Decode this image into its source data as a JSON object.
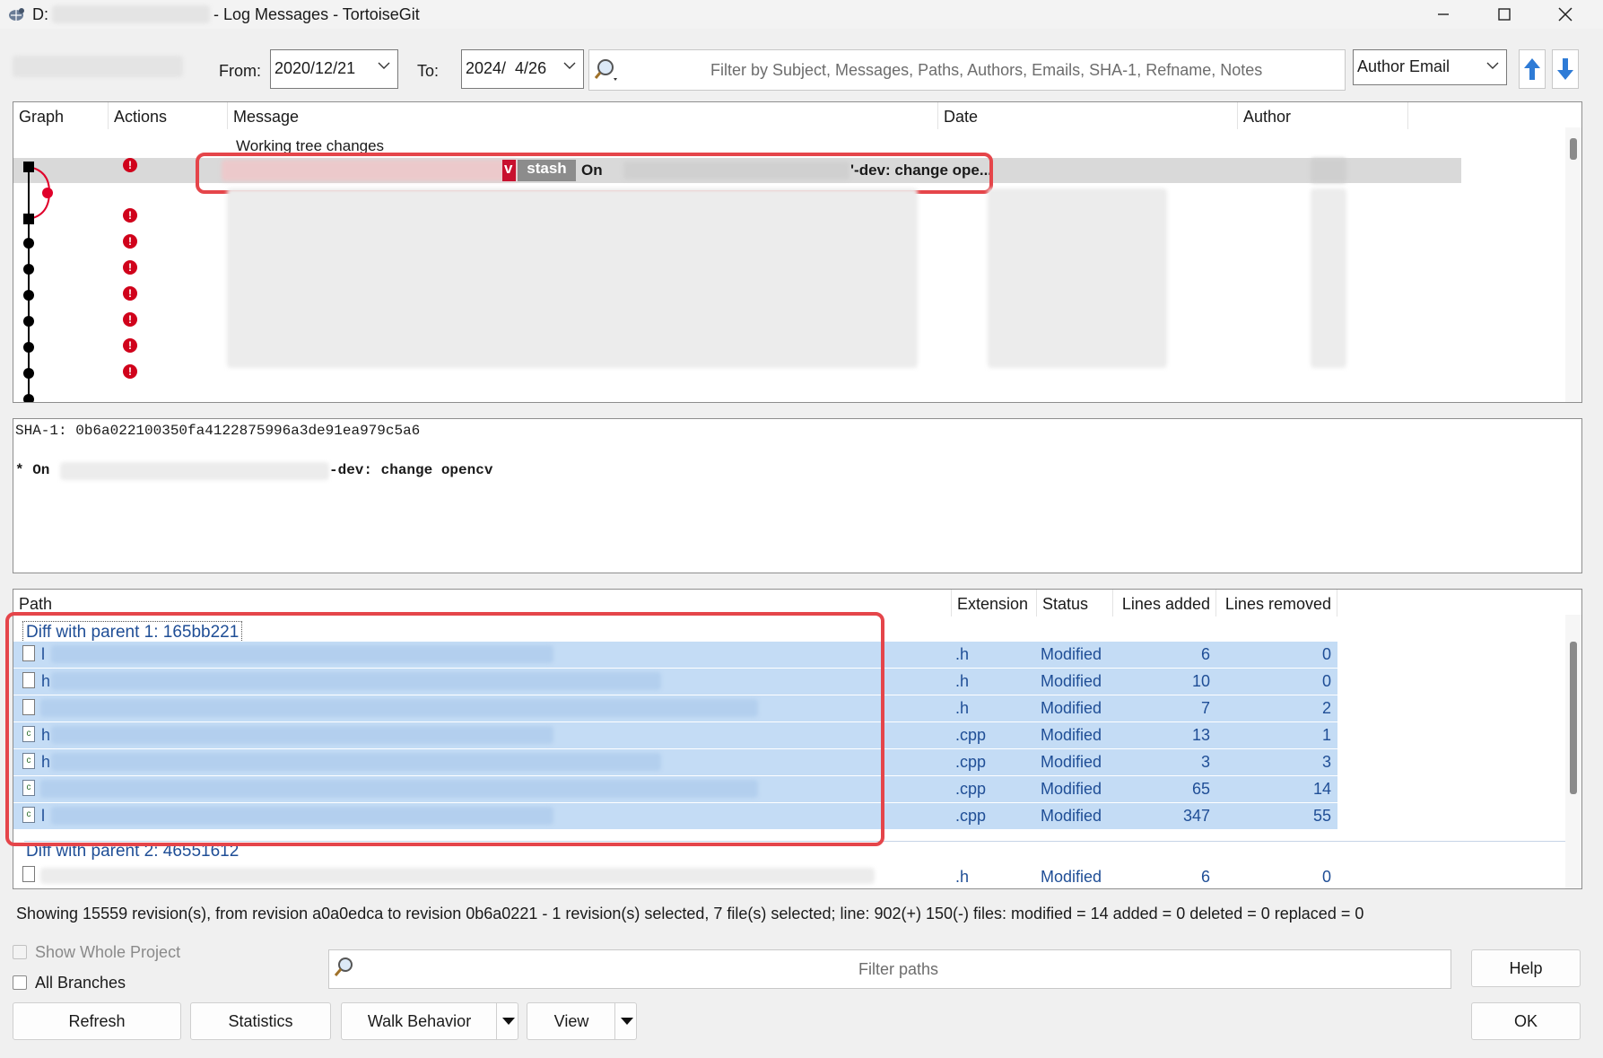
{
  "window": {
    "title_prefix": "D:",
    "title_suffix": "- Log Messages - TortoiseGit"
  },
  "toolbar": {
    "from_label": "From:",
    "from_value": "2020/12/21",
    "to_label": "To:",
    "to_value": "2024/  4/26",
    "filter_placeholder": "Filter by Subject, Messages, Paths, Authors, Emails, SHA-1, Refname, Notes",
    "filter_field_value": "Author Email"
  },
  "log": {
    "columns": [
      "Graph",
      "Actions",
      "Message",
      "Date",
      "Author"
    ],
    "working_tree": "Working tree changes",
    "selected_ref_char": "v",
    "selected_ref_label": "stash",
    "selected_msg_start": "On",
    "selected_msg_end": "'-dev: change ope..."
  },
  "details": {
    "sha": "SHA-1: 0b6a022100350fa4122875996a3de91ea979c5a6",
    "msg_prefix": "* On",
    "msg_suffix": "-dev: change opencv"
  },
  "files": {
    "columns": [
      "Path",
      "Extension",
      "Status",
      "Lines added",
      "Lines removed"
    ],
    "group1": "Diff with parent 1: 165bb221",
    "group2": "Diff with parent 2: 46551612",
    "rows": [
      {
        "prefix": "l",
        "ext": ".h",
        "status": "Modified",
        "added": "6",
        "removed": "0",
        "icon": "file-icon"
      },
      {
        "prefix": "h",
        "ext": ".h",
        "status": "Modified",
        "added": "10",
        "removed": "0",
        "icon": "file-icon"
      },
      {
        "prefix": "",
        "ext": ".h",
        "status": "Modified",
        "added": "7",
        "removed": "2",
        "icon": "file-icon"
      },
      {
        "prefix": "h",
        "ext": ".cpp",
        "status": "Modified",
        "added": "13",
        "removed": "1",
        "icon": "cpp-file-icon"
      },
      {
        "prefix": "h",
        "ext": ".cpp",
        "status": "Modified",
        "added": "3",
        "removed": "3",
        "icon": "cpp-file-icon"
      },
      {
        "prefix": "",
        "ext": ".cpp",
        "status": "Modified",
        "added": "65",
        "removed": "14",
        "icon": "cpp-file-icon"
      },
      {
        "prefix": "l",
        "ext": ".cpp",
        "status": "Modified",
        "added": "347",
        "removed": "55",
        "icon": "cpp-file-icon"
      }
    ],
    "group2_row": {
      "ext": ".h",
      "status": "Modified",
      "added": "6",
      "removed": "0"
    }
  },
  "status_text": "Showing 15559 revision(s), from revision a0a0edca to revision 0b6a0221 - 1 revision(s) selected, 7 file(s) selected; line: 902(+) 150(-) files: modified = 14 added = 0 deleted = 0 replaced = 0",
  "bottom": {
    "show_whole_project": "Show Whole Project",
    "all_branches": "All Branches",
    "filter_paths_placeholder": "Filter paths",
    "help": "Help",
    "refresh": "Refresh",
    "statistics": "Statistics",
    "walk_behavior": "Walk Behavior",
    "view": "View",
    "ok": "OK"
  },
  "colors": {
    "selection_blue": "#c4dcf5",
    "link_blue": "#1f4e96",
    "highlight_red": "#e5454a",
    "ref_red": "#c8102e",
    "ref_gray": "#8c8c8c"
  }
}
